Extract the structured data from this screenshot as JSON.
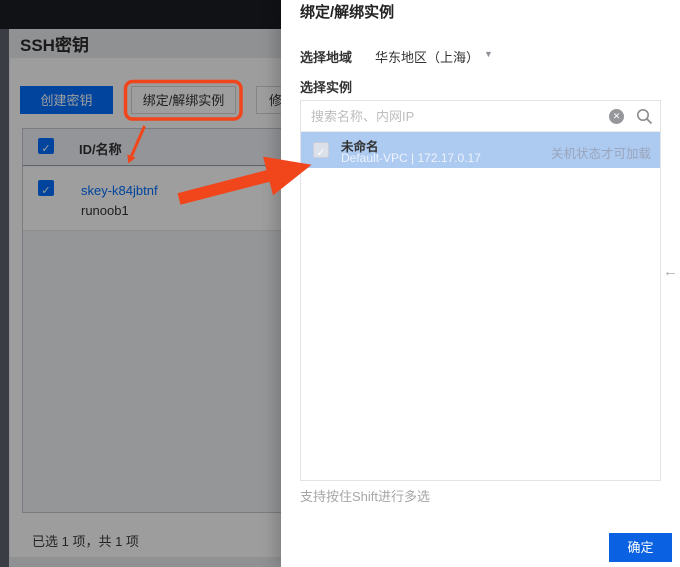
{
  "console": {
    "page_title": "SSH密钥",
    "toolbar": {
      "create_label": "创建密钥",
      "bind_label": "绑定/解绑实例",
      "modify_label": "修"
    },
    "table": {
      "header": "ID/名称",
      "row": {
        "id": "skey-k84jbtnf",
        "name": "runoob1"
      }
    },
    "footer_summary": "已选 1 项，共 1 项"
  },
  "modal": {
    "title": "绑定/解绑实例",
    "region_label": "选择地域",
    "region_value": "华东地区（上海）",
    "instance_label": "选择实例",
    "search": {
      "placeholder": "搜索名称、内网IP"
    },
    "instance": {
      "name": "未命名",
      "detail": "Default-VPC | 172.17.0.17",
      "status_hint": "关机状态才可加载"
    },
    "multi_select_hint": "支持按住Shift进行多选",
    "confirm_label": "确定"
  },
  "icons": {
    "check": "✓",
    "clear": "✕",
    "caret_down": "▼",
    "collapse_left": "←"
  },
  "colors": {
    "primary_blue": "#006eff",
    "confirm_blue": "#0a62e2",
    "selected_row_blue": "#adcaf1",
    "annotation_orange": "#f1451c",
    "topbar_dark": "#1b1e25"
  }
}
